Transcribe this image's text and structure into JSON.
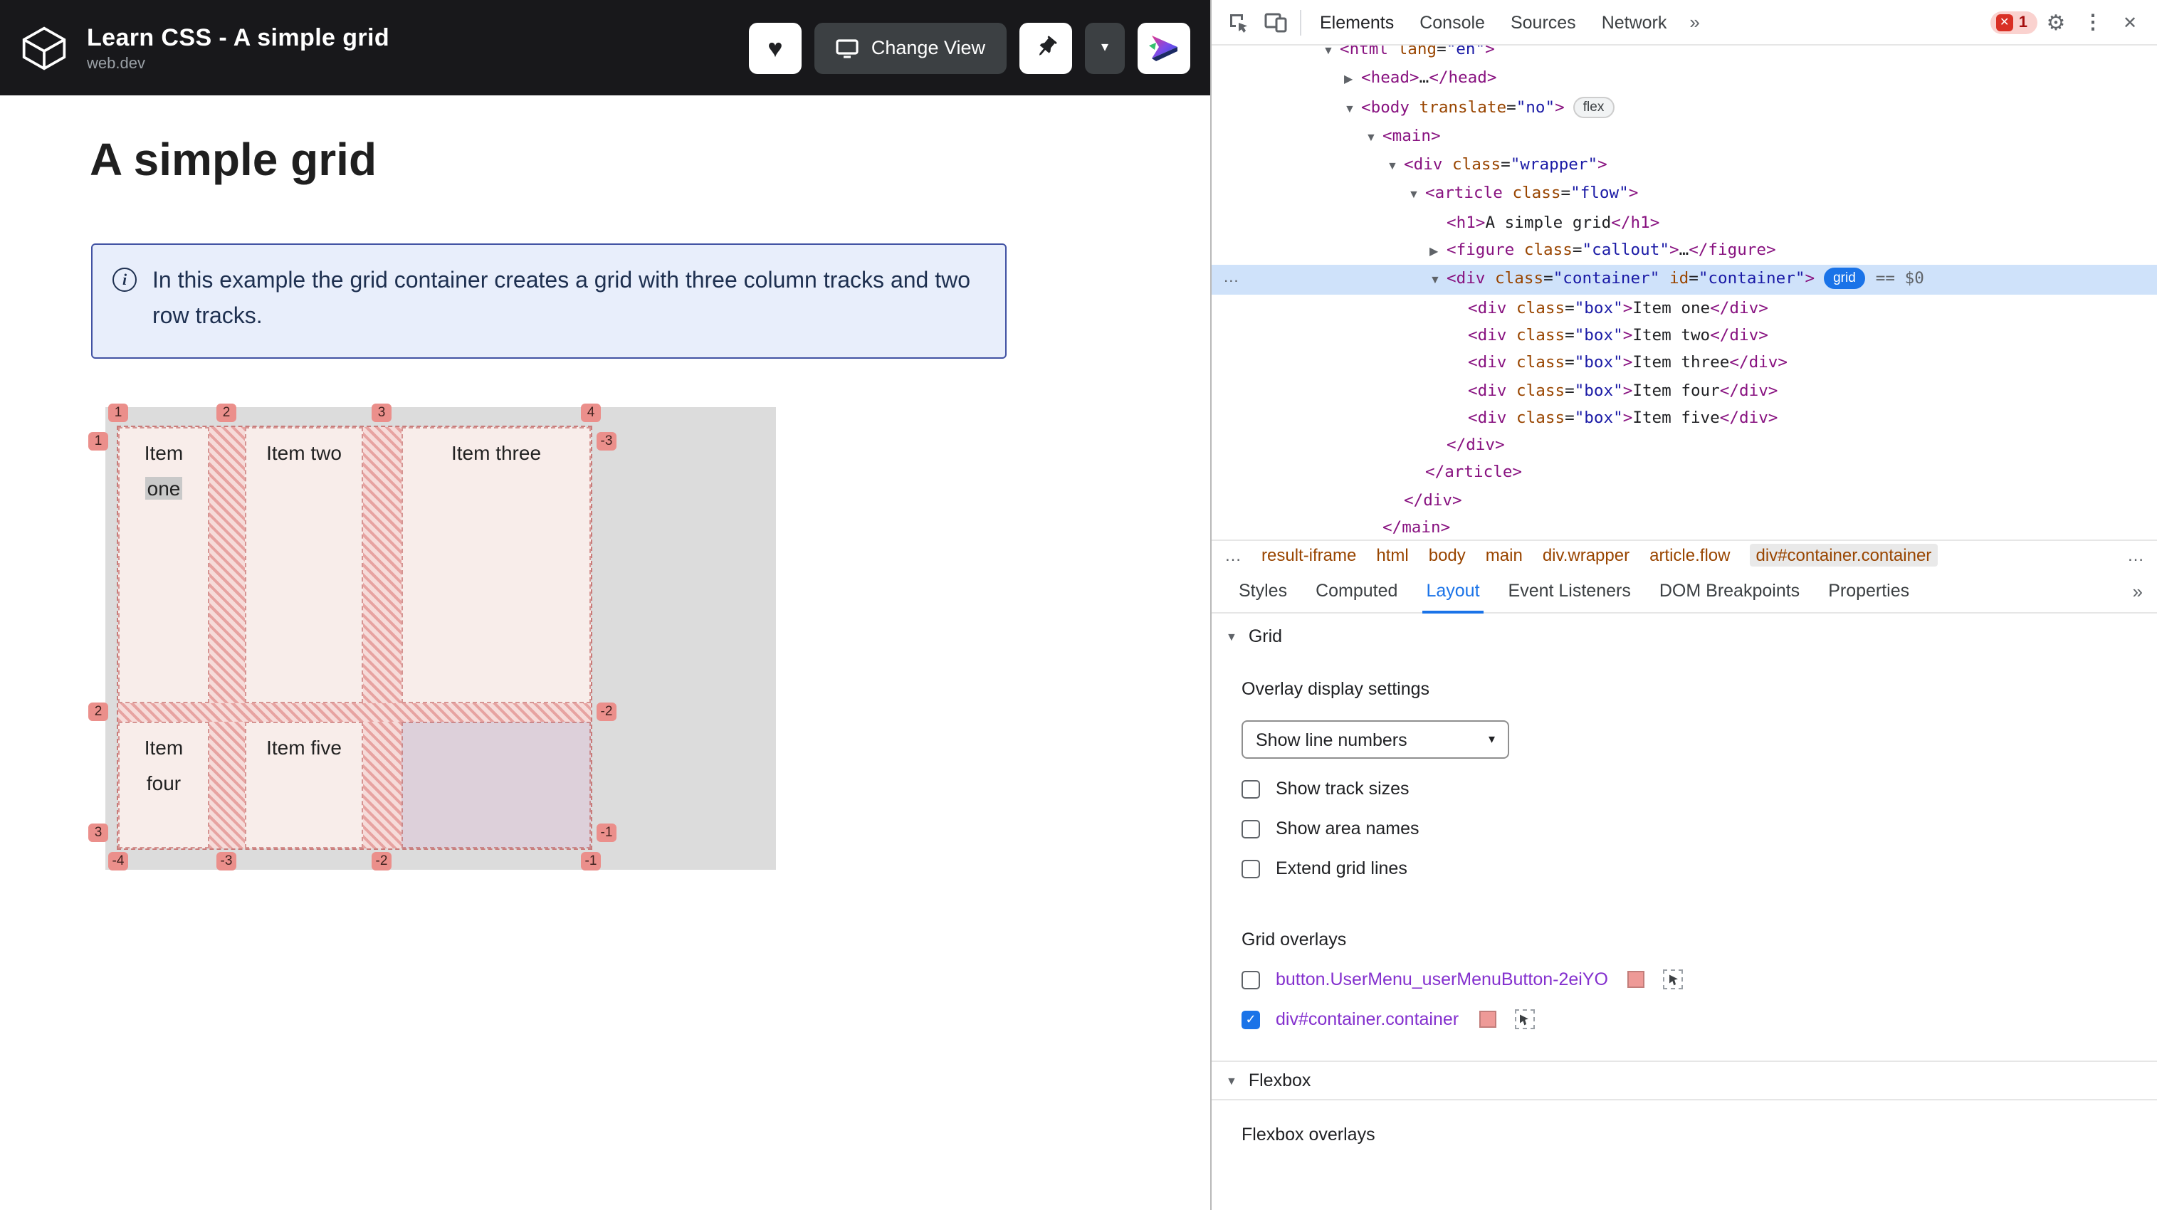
{
  "colors": {
    "accent_blue": "#1a73e8",
    "grid_overlay": "#eb8f8b",
    "header_bg": "#18181b"
  },
  "icons": {
    "heart": "♥",
    "chevron_down": "▾",
    "gear": "⚙",
    "kebab": "⋮",
    "close": "✕",
    "select_arrow": "▾",
    "triangle_down": "▼",
    "tree_open": "▼",
    "tree_closed": "▶",
    "error_x": "✕",
    "info": "i",
    "overflow": "…"
  },
  "header": {
    "title": "Learn CSS - A simple grid",
    "subtitle": "web.dev",
    "change_view_label": "Change View"
  },
  "page": {
    "heading": "A simple grid",
    "callout_text": "In this example the grid container creates a grid with three column tracks and two row tracks."
  },
  "grid_demo": {
    "items": [
      {
        "label": "Item one",
        "highlight": "one",
        "cell": "r1c1"
      },
      {
        "label": "Item two",
        "cell": "r1c2"
      },
      {
        "label": "Item three",
        "cell": "r1c3"
      },
      {
        "label": "Item four",
        "cell": "r2c1"
      },
      {
        "label": "Item five",
        "cell": "r2c2"
      }
    ],
    "line_numbers": {
      "top": [
        "1",
        "2",
        "3",
        "4"
      ],
      "bottom": [
        "-4",
        "-3",
        "-2",
        "-1"
      ],
      "left": [
        "1",
        "2",
        "3"
      ],
      "right": [
        "-3",
        "-2",
        "-1"
      ]
    }
  },
  "devtools": {
    "toolbar": {
      "tabs": [
        "Elements",
        "Console",
        "Sources",
        "Network"
      ],
      "more_tabs": "»",
      "error_count": "1"
    },
    "tree": [
      {
        "indent": 0,
        "arrow": "open",
        "clip": true,
        "tokens": [
          [
            "tag",
            "<html "
          ],
          [
            "attr",
            "lang"
          ],
          [
            "p",
            "="
          ],
          [
            "val",
            "\"en\""
          ],
          [
            "tag",
            ">"
          ]
        ]
      },
      {
        "indent": 1,
        "arrow": "closed",
        "tokens": [
          [
            "tag",
            "<head>"
          ],
          [
            "p",
            "…"
          ],
          [
            "tag",
            "</head>"
          ]
        ]
      },
      {
        "indent": 1,
        "arrow": "open",
        "badge": "flex",
        "tokens": [
          [
            "tag",
            "<body "
          ],
          [
            "attr",
            "translate"
          ],
          [
            "p",
            "="
          ],
          [
            "val",
            "\"no\""
          ],
          [
            "tag",
            ">"
          ]
        ]
      },
      {
        "indent": 2,
        "arrow": "open",
        "tokens": [
          [
            "tag",
            "<main>"
          ]
        ]
      },
      {
        "indent": 3,
        "arrow": "open",
        "tokens": [
          [
            "tag",
            "<div "
          ],
          [
            "attr",
            "class"
          ],
          [
            "p",
            "="
          ],
          [
            "val",
            "\"wrapper\""
          ],
          [
            "tag",
            ">"
          ]
        ]
      },
      {
        "indent": 4,
        "arrow": "open",
        "tokens": [
          [
            "tag",
            "<article "
          ],
          [
            "attr",
            "class"
          ],
          [
            "p",
            "="
          ],
          [
            "val",
            "\"flow\""
          ],
          [
            "tag",
            ">"
          ]
        ]
      },
      {
        "indent": 5,
        "tokens": [
          [
            "tag",
            "<h1>"
          ],
          [
            "text",
            "A simple grid"
          ],
          [
            "tag",
            "</h1>"
          ]
        ]
      },
      {
        "indent": 5,
        "arrow": "closed",
        "tokens": [
          [
            "tag",
            "<figure "
          ],
          [
            "attr",
            "class"
          ],
          [
            "p",
            "="
          ],
          [
            "val",
            "\"callout\""
          ],
          [
            "tag",
            ">"
          ],
          [
            "p",
            "…"
          ],
          [
            "tag",
            "</figure>"
          ]
        ]
      },
      {
        "indent": 5,
        "arrow": "open",
        "highlight": true,
        "gutter": "…",
        "badge": "grid",
        "suffix": "== $0",
        "tokens": [
          [
            "tag",
            "<div "
          ],
          [
            "attr",
            "class"
          ],
          [
            "p",
            "="
          ],
          [
            "val",
            "\"container\""
          ],
          [
            "p",
            " "
          ],
          [
            "attr",
            "id"
          ],
          [
            "p",
            "="
          ],
          [
            "val",
            "\"container\""
          ],
          [
            "tag",
            ">"
          ]
        ]
      },
      {
        "indent": 6,
        "tokens": [
          [
            "tag",
            "<div "
          ],
          [
            "attr",
            "class"
          ],
          [
            "p",
            "="
          ],
          [
            "val",
            "\"box\""
          ],
          [
            "tag",
            ">"
          ],
          [
            "text",
            "Item one"
          ],
          [
            "tag",
            "</div>"
          ]
        ]
      },
      {
        "indent": 6,
        "tokens": [
          [
            "tag",
            "<div "
          ],
          [
            "attr",
            "class"
          ],
          [
            "p",
            "="
          ],
          [
            "val",
            "\"box\""
          ],
          [
            "tag",
            ">"
          ],
          [
            "text",
            "Item two"
          ],
          [
            "tag",
            "</div>"
          ]
        ]
      },
      {
        "indent": 6,
        "tokens": [
          [
            "tag",
            "<div "
          ],
          [
            "attr",
            "class"
          ],
          [
            "p",
            "="
          ],
          [
            "val",
            "\"box\""
          ],
          [
            "tag",
            ">"
          ],
          [
            "text",
            "Item three"
          ],
          [
            "tag",
            "</div>"
          ]
        ]
      },
      {
        "indent": 6,
        "tokens": [
          [
            "tag",
            "<div "
          ],
          [
            "attr",
            "class"
          ],
          [
            "p",
            "="
          ],
          [
            "val",
            "\"box\""
          ],
          [
            "tag",
            ">"
          ],
          [
            "text",
            "Item four"
          ],
          [
            "tag",
            "</div>"
          ]
        ]
      },
      {
        "indent": 6,
        "tokens": [
          [
            "tag",
            "<div "
          ],
          [
            "attr",
            "class"
          ],
          [
            "p",
            "="
          ],
          [
            "val",
            "\"box\""
          ],
          [
            "tag",
            ">"
          ],
          [
            "text",
            "Item five"
          ],
          [
            "tag",
            "</div>"
          ]
        ]
      },
      {
        "indent": 5,
        "tokens": [
          [
            "tag",
            "</div>"
          ]
        ]
      },
      {
        "indent": 4,
        "tokens": [
          [
            "tag",
            "</article>"
          ]
        ]
      },
      {
        "indent": 3,
        "tokens": [
          [
            "tag",
            "</div>"
          ]
        ]
      },
      {
        "indent": 2,
        "tokens": [
          [
            "tag",
            "</main>"
          ]
        ]
      }
    ],
    "breadcrumbs": {
      "overflow": "…",
      "trailing": "…",
      "items": [
        "result-iframe",
        "html",
        "body",
        "main",
        "div.wrapper",
        "article.flow",
        "div#container.container"
      ],
      "selected": "div#container.container"
    },
    "panel_tabs": {
      "items": [
        "Styles",
        "Computed",
        "Layout",
        "Event Listeners",
        "DOM Breakpoints",
        "Properties"
      ],
      "selected": "Layout",
      "more": "»"
    },
    "layout": {
      "grid_section": "Grid",
      "overlay_settings_title": "Overlay display settings",
      "line_numbers_select": "Show line numbers",
      "options": [
        {
          "label": "Show track sizes",
          "checked": false
        },
        {
          "label": "Show area names",
          "checked": false
        },
        {
          "label": "Extend grid lines",
          "checked": false
        }
      ],
      "grid_overlays_title": "Grid overlays",
      "grid_overlays": [
        {
          "label": "button.UserMenu_userMenuButton-2eiYO",
          "checked": false,
          "color": "#ee9a97"
        },
        {
          "label": "div#container.container",
          "checked": true,
          "color": "#ee9a97"
        }
      ],
      "flexbox_section": "Flexbox",
      "flexbox_overlays_title": "Flexbox overlays"
    }
  }
}
